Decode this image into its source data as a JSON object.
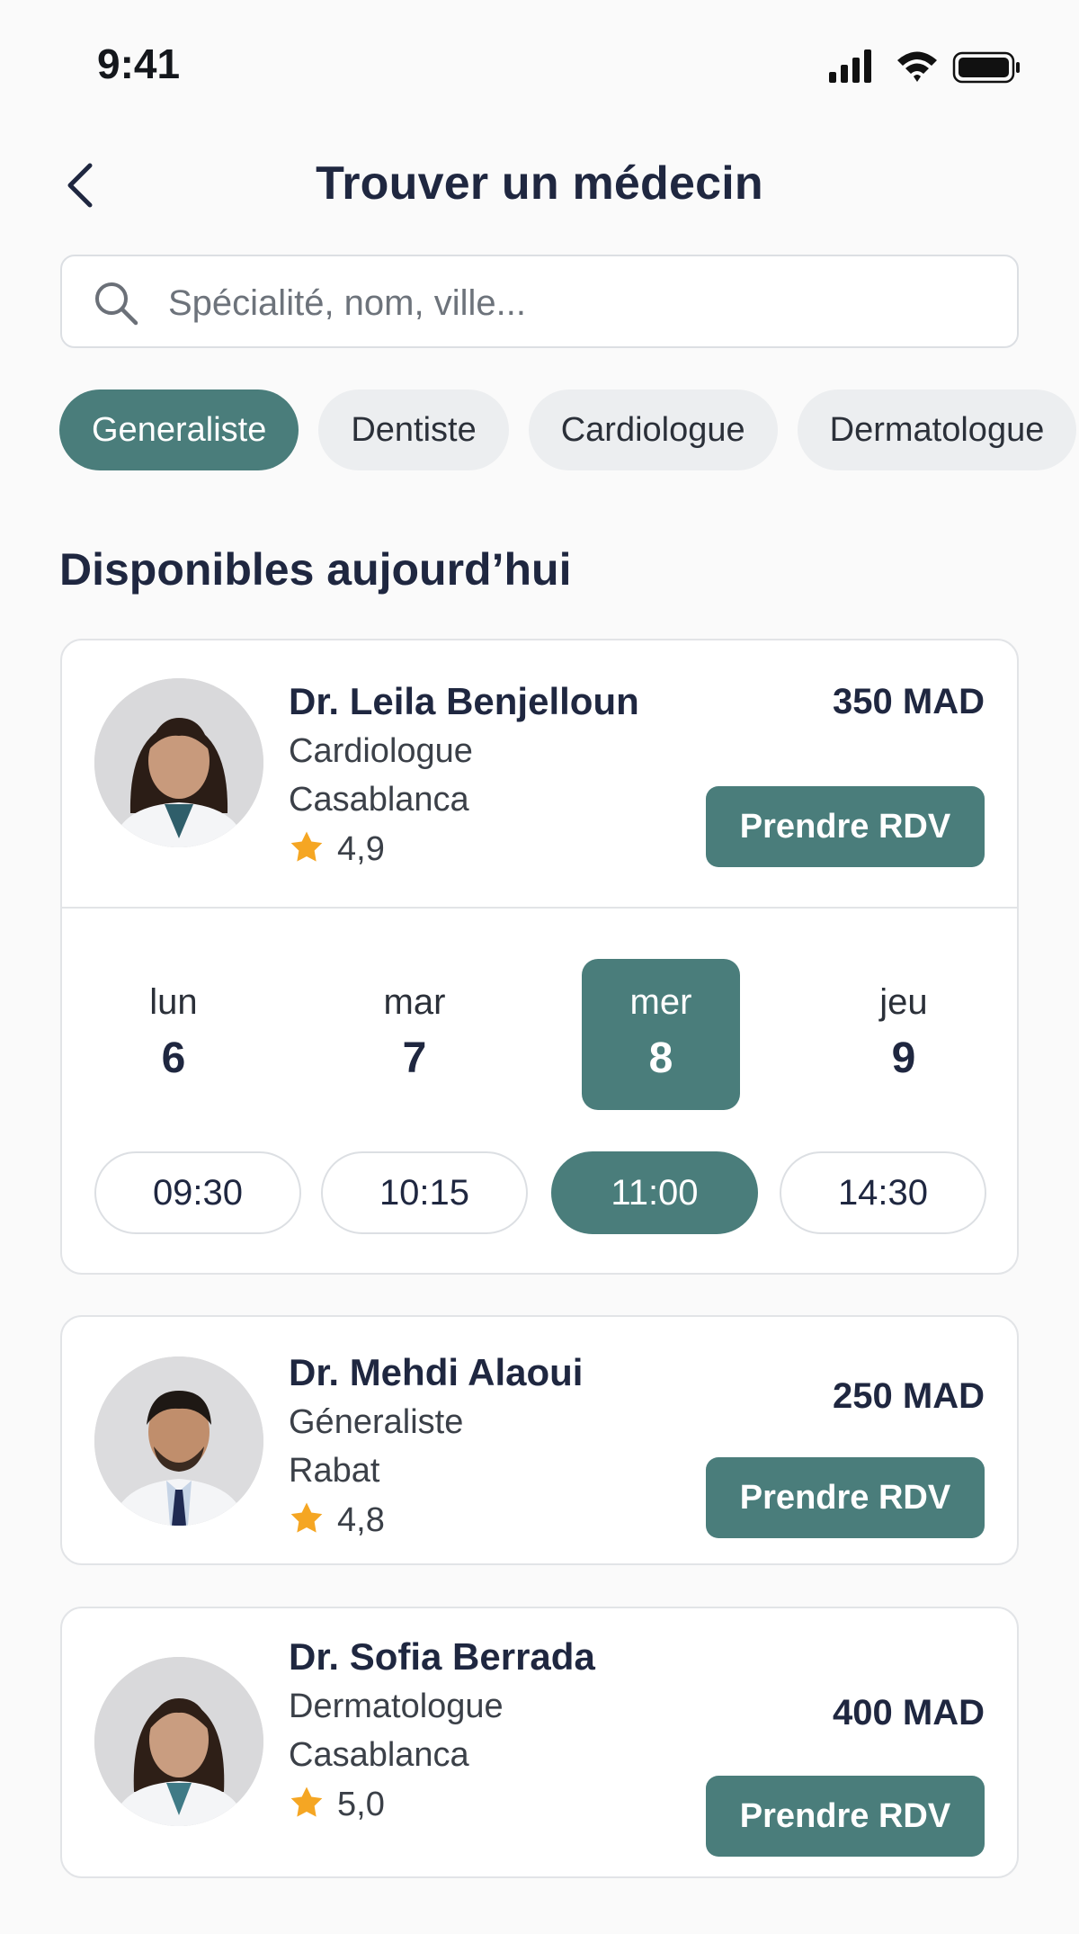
{
  "status_bar": {
    "time": "9:41"
  },
  "header": {
    "title": "Trouver un médecin"
  },
  "search": {
    "placeholder": "Spécialité, nom, ville..."
  },
  "chips": [
    "Generaliste",
    "Dentiste",
    "Cardiologue",
    "Dermatologue"
  ],
  "active_chip": "Generaliste",
  "section_title": "Disponibles aujourd’hui",
  "doctors": [
    {
      "name": "Dr. Leila Benjelloun",
      "specialty": "Cardiologue",
      "city": "Casablanca",
      "rating": "4,9",
      "price": "350 MAD",
      "button": "Prendre RDV",
      "days": [
        {
          "name": "lun",
          "num": "6"
        },
        {
          "name": "mar",
          "num": "7"
        },
        {
          "name": "mer",
          "num": "8"
        },
        {
          "name": "jeu",
          "num": "9"
        }
      ],
      "selected_day": "mer 8",
      "slots": [
        "09:30",
        "10:15",
        "11:00",
        "14:30"
      ],
      "selected_slot": "11:00"
    },
    {
      "name": "Dr. Mehdi Alaoui",
      "specialty": "Géneraliste",
      "city": "Rabat",
      "rating": "4,8",
      "price": "250 MAD",
      "button": "Prendre RDV"
    },
    {
      "name": "Dr. Sofia Berrada",
      "specialty": "Dermatologue",
      "city": "Casablanca",
      "rating": "5,0",
      "price": "400 MAD",
      "button": "Prendre RDV"
    }
  ],
  "colors": {
    "accent": "#4a7d7b",
    "chip_bg": "#eceef0",
    "title": "#1f2740",
    "star": "#f5a623"
  },
  "icons": [
    "signal-icon",
    "wifi-icon",
    "battery-icon",
    "back-chevron-icon",
    "search-icon",
    "star-icon"
  ]
}
